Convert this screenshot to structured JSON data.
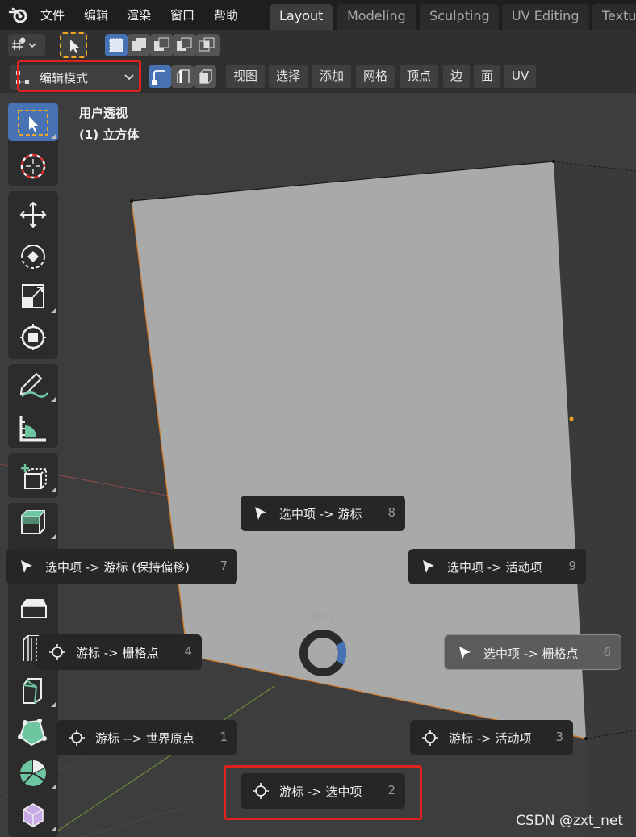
{
  "topbar": {
    "menus": [
      "文件",
      "编辑",
      "渲染",
      "窗口",
      "帮助"
    ],
    "workspaces": [
      "Layout",
      "Modeling",
      "Sculpting",
      "UV Editing",
      "Textu"
    ],
    "active_workspace": "Layout"
  },
  "edit_header": {
    "mode_label": "编辑模式",
    "menus": [
      "视图",
      "选择",
      "添加",
      "网格",
      "顶点",
      "边",
      "面",
      "UV"
    ]
  },
  "viewport": {
    "view_name": "用户透视",
    "object_name": "(1) 立方体"
  },
  "pie_menu": {
    "title": "吸附",
    "items": [
      {
        "label": "选中项 -> 游标",
        "shortcut": "8",
        "icon": "cursor-arrow-icon",
        "highlighted": false
      },
      {
        "label": "选中项 -> 游标 (保持偏移)",
        "shortcut": "7",
        "icon": "cursor-arrow-icon",
        "highlighted": false
      },
      {
        "label": "选中项 -> 活动项",
        "shortcut": "9",
        "icon": "cursor-arrow-icon",
        "highlighted": false
      },
      {
        "label": "游标 -> 栅格点",
        "shortcut": "4",
        "icon": "3d-cursor-icon",
        "highlighted": false
      },
      {
        "label": "选中项 -> 栅格点",
        "shortcut": "6",
        "icon": "cursor-arrow-icon",
        "highlighted": true
      },
      {
        "label": "游标 --> 世界原点",
        "shortcut": "1",
        "icon": "3d-cursor-icon",
        "highlighted": false
      },
      {
        "label": "游标 -> 活动项",
        "shortcut": "3",
        "icon": "3d-cursor-icon",
        "highlighted": false
      },
      {
        "label": "游标 -> 选中项",
        "shortcut": "2",
        "icon": "3d-cursor-icon",
        "highlighted": false
      }
    ]
  },
  "watermark": "CSDN @zxt_net",
  "colors": {
    "accent_blue": "#4772b3",
    "annotation_red": "#e0241b",
    "selection_orange": "#f5a623",
    "cube_face": "#a8aaa9"
  }
}
